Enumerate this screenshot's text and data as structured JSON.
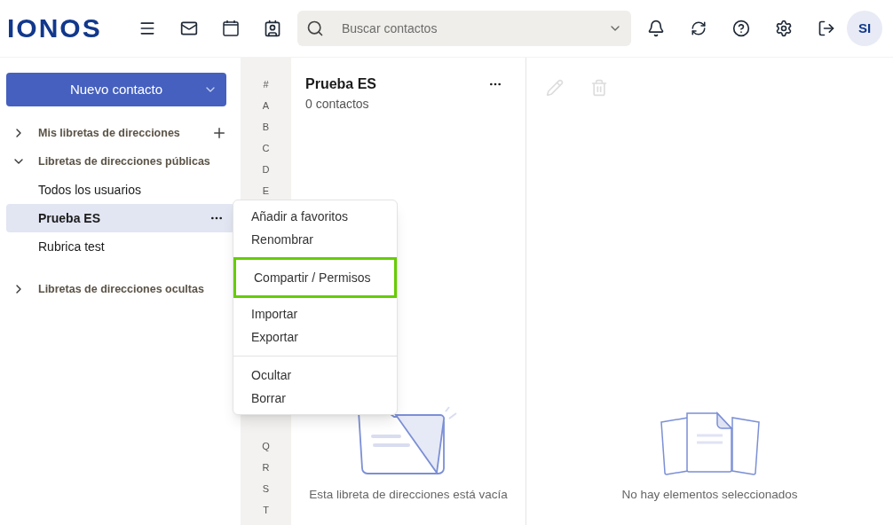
{
  "header": {
    "logo": "IONOS",
    "search": {
      "placeholder": "Buscar contactos"
    },
    "avatar": "SI"
  },
  "sidebar": {
    "new_button": "Nuevo contacto",
    "sections": [
      {
        "label": "Mis libretas de direcciones",
        "expanded": false,
        "can_add": true
      },
      {
        "label": "Libretas de direcciones públicas",
        "expanded": true,
        "can_add": false,
        "items": [
          {
            "label": "Todos los usuarios",
            "selected": false
          },
          {
            "label": "Prueba ES",
            "selected": true
          },
          {
            "label": "Rubrica test",
            "selected": false
          }
        ]
      },
      {
        "label": "Libretas de direcciones ocultas",
        "expanded": false,
        "can_add": false
      }
    ]
  },
  "alphabet_index": {
    "top": [
      "#",
      "A",
      "B",
      "C",
      "D",
      "E"
    ],
    "bottom": [
      "Q",
      "R",
      "S",
      "T"
    ]
  },
  "list": {
    "title": "Prueba ES",
    "count": "0 contactos",
    "empty_text": "Esta libreta de direcciones está vacía"
  },
  "detail": {
    "empty_text": "No hay elementos seleccionados"
  },
  "context_menu": [
    [
      {
        "label": "Añadir a favoritos",
        "highlighted": false
      },
      {
        "label": "Renombrar",
        "highlighted": false
      }
    ],
    [
      {
        "label": "Compartir / Permisos",
        "highlighted": true
      }
    ],
    [
      {
        "label": "Importar",
        "highlighted": false
      },
      {
        "label": "Exportar",
        "highlighted": false
      }
    ],
    [
      {
        "label": "Ocultar",
        "highlighted": false
      },
      {
        "label": "Borrar",
        "highlighted": false
      }
    ]
  ]
}
